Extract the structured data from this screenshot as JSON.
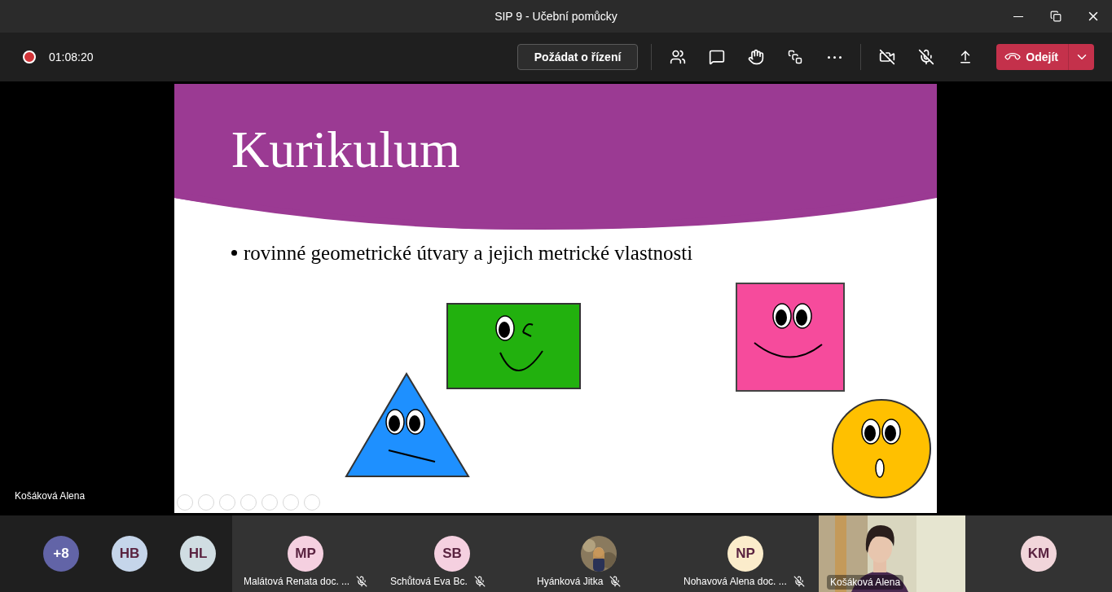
{
  "window": {
    "title": "SIP 9 - Učební pomůcky"
  },
  "toolbar": {
    "recording": true,
    "elapsed": "01:08:20",
    "request_control": "Požádat o řízení",
    "camera_on": false,
    "mic_on": false,
    "leave": "Odejít"
  },
  "stage": {
    "presenter": "Košáková Alena",
    "slide": {
      "title": "Kurikulum",
      "bullets": [
        "rovinné geometrické útvary a jejich metrické vlastnosti"
      ]
    }
  },
  "participants": [
    {
      "kind": "overflow",
      "initials": "+8",
      "color": "#6264a7"
    },
    {
      "kind": "avatar",
      "initials": "HB",
      "color": "#c5d5ea"
    },
    {
      "kind": "avatar",
      "initials": "HL",
      "color": "#d0dde2"
    },
    {
      "kind": "tile",
      "initials": "MP",
      "color": "#f5d0e0",
      "name": "Malátová Renata doc. ...",
      "muted": true
    },
    {
      "kind": "tile",
      "initials": "SB",
      "color": "#f5d0e0",
      "name": "Schůtová Eva Bc.",
      "muted": true
    },
    {
      "name": "Hyánková Jitka",
      "muted": true
    },
    {
      "kind": "tile",
      "initials": "NP",
      "color": "#fbeccb",
      "name": "Nohavová Alena doc. ...",
      "muted": true
    },
    {
      "kind": "video",
      "name": "Košáková Alena",
      "muted": false
    },
    {
      "kind": "tile",
      "initials": "KM",
      "color": "#f1d5da"
    }
  ]
}
